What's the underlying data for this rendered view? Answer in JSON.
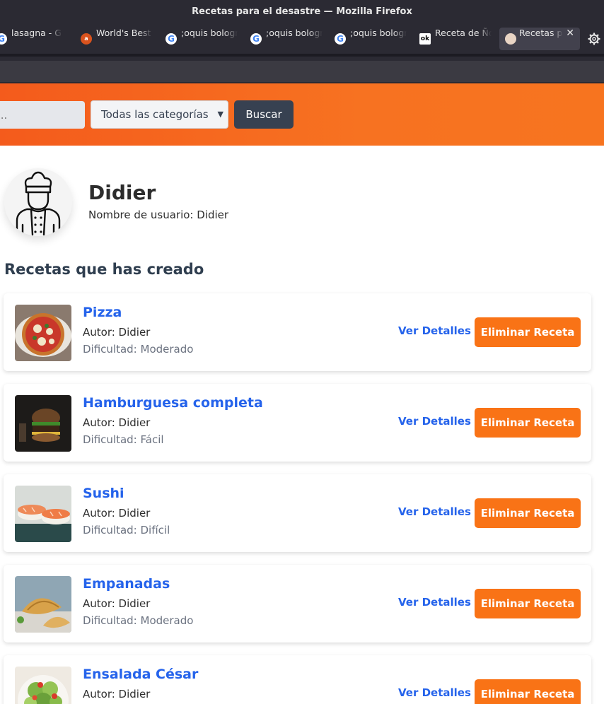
{
  "browser": {
    "window_title": "Recetas para el desastre — Mozilla Firefox",
    "tabs": [
      {
        "label": "lasagna - Goo",
        "icon": "google-icon"
      },
      {
        "label": "World's Best",
        "icon": "allrecipes-icon"
      },
      {
        "label": ";oquis bologn",
        "icon": "google-icon"
      },
      {
        "label": ";oquis bologn",
        "icon": "google-icon"
      },
      {
        "label": ";oquis bologn",
        "icon": "google-icon"
      },
      {
        "label": "Receta de Ño",
        "icon": "ok-icon"
      },
      {
        "label": "Recetas pa",
        "icon": "chef-favicon",
        "active": true
      }
    ]
  },
  "header": {
    "search_placeholder": "...",
    "category_selected": "Todas las categorías",
    "search_button": "Buscar",
    "gradient_from": "#f45b1c",
    "gradient_to": "#f7741f"
  },
  "profile": {
    "name": "Didier",
    "username_line": "Nombre de usuario: Didier"
  },
  "section_title": "Recetas que has creado",
  "recipes": [
    {
      "title": "Pizza",
      "author": "Autor: Didier",
      "difficulty": "Dificultad: Moderado",
      "details": "Ver Detalles",
      "delete": "Eliminar Receta",
      "image": "pizza"
    },
    {
      "title": "Hamburguesa completa",
      "author": "Autor: Didier",
      "difficulty": "Dificultad: Fácil",
      "details": "Ver Detalles",
      "delete": "Eliminar Receta",
      "image": "burger"
    },
    {
      "title": "Sushi",
      "author": "Autor: Didier",
      "difficulty": "Dificultad: Difícil",
      "details": "Ver Detalles",
      "delete": "Eliminar Receta",
      "image": "sushi"
    },
    {
      "title": "Empanadas",
      "author": "Autor: Didier",
      "difficulty": "Dificultad: Moderado",
      "details": "Ver Detalles",
      "delete": "Eliminar Receta",
      "image": "empanadas"
    },
    {
      "title": "Ensalada César",
      "author": "Autor: Didier",
      "difficulty": "",
      "details": "Ver Detalles",
      "delete": "Eliminar Receta",
      "image": "salad"
    }
  ],
  "colors": {
    "link": "#2563eb",
    "delete_button": "#f97316",
    "search_button": "#374151"
  }
}
